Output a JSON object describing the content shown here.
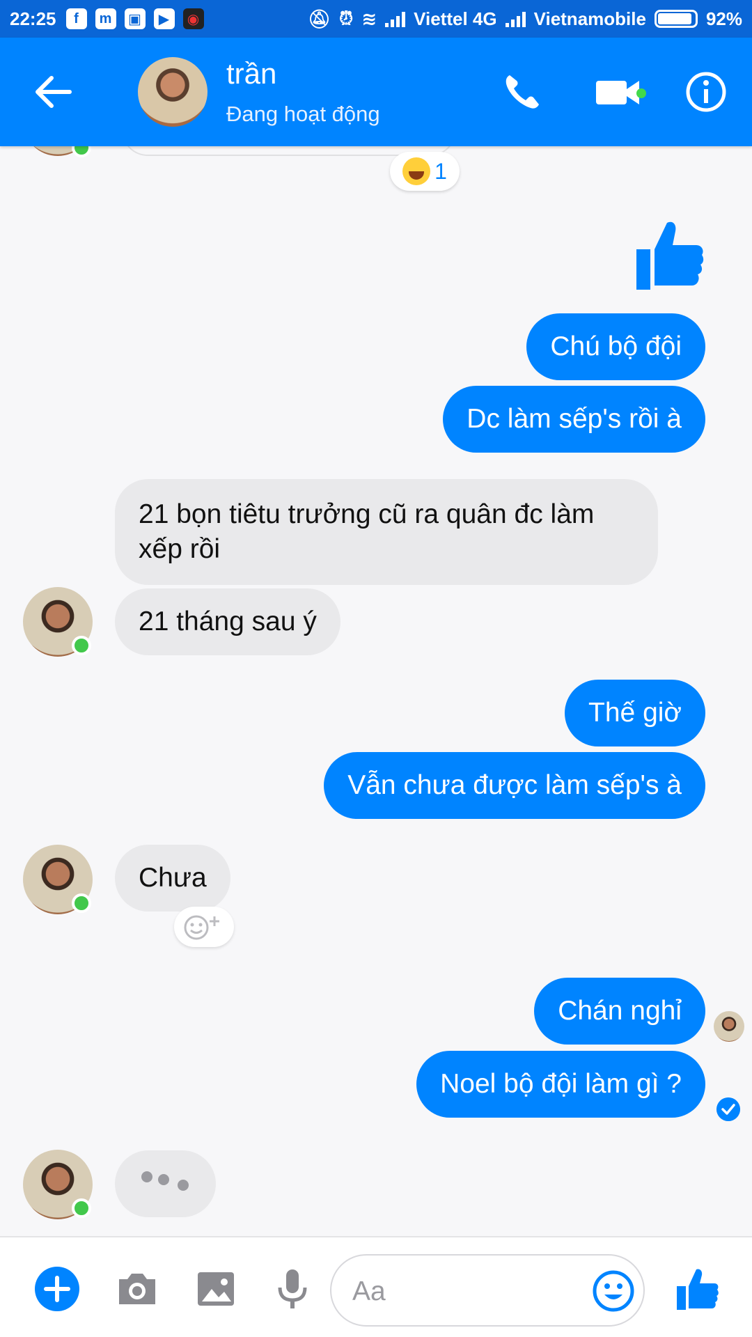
{
  "status_bar": {
    "time": "22:25",
    "carrier1": "Viettel 4G",
    "carrier2": "Vietnamobile",
    "battery": "92%",
    "battery_level": 0.92
  },
  "header": {
    "name": "trần",
    "status": "Đang hoạt động"
  },
  "reaction": {
    "count": "1"
  },
  "messages": {
    "m1": "Chú bộ đội",
    "m2": "Dc làm sếp's rồi à",
    "m3": "21 bọn tiêtu trưởng cũ ra quân đc làm xếp rồi",
    "m4": "21 tháng sau ý",
    "m5": "Thế giờ",
    "m6": "Vẫn chưa được làm sếp's à",
    "m7": "Chưa",
    "m8": "Chán nghỉ",
    "m9": "Noel bộ đội làm gì ?"
  },
  "composer": {
    "placeholder": "Aa"
  },
  "colors": {
    "brand": "#0084ff",
    "active": "#42c84b",
    "incoming": "#e9e9eb"
  }
}
